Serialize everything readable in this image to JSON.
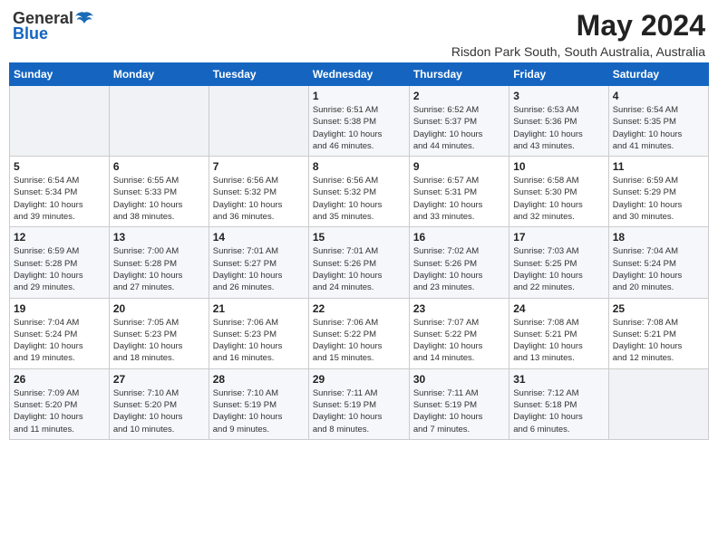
{
  "header": {
    "logo_general": "General",
    "logo_blue": "Blue",
    "month_year": "May 2024",
    "location": "Risdon Park South, South Australia, Australia"
  },
  "weekdays": [
    "Sunday",
    "Monday",
    "Tuesday",
    "Wednesday",
    "Thursday",
    "Friday",
    "Saturday"
  ],
  "weeks": [
    [
      {
        "day": "",
        "info": ""
      },
      {
        "day": "",
        "info": ""
      },
      {
        "day": "",
        "info": ""
      },
      {
        "day": "1",
        "info": "Sunrise: 6:51 AM\nSunset: 5:38 PM\nDaylight: 10 hours\nand 46 minutes."
      },
      {
        "day": "2",
        "info": "Sunrise: 6:52 AM\nSunset: 5:37 PM\nDaylight: 10 hours\nand 44 minutes."
      },
      {
        "day": "3",
        "info": "Sunrise: 6:53 AM\nSunset: 5:36 PM\nDaylight: 10 hours\nand 43 minutes."
      },
      {
        "day": "4",
        "info": "Sunrise: 6:54 AM\nSunset: 5:35 PM\nDaylight: 10 hours\nand 41 minutes."
      }
    ],
    [
      {
        "day": "5",
        "info": "Sunrise: 6:54 AM\nSunset: 5:34 PM\nDaylight: 10 hours\nand 39 minutes."
      },
      {
        "day": "6",
        "info": "Sunrise: 6:55 AM\nSunset: 5:33 PM\nDaylight: 10 hours\nand 38 minutes."
      },
      {
        "day": "7",
        "info": "Sunrise: 6:56 AM\nSunset: 5:32 PM\nDaylight: 10 hours\nand 36 minutes."
      },
      {
        "day": "8",
        "info": "Sunrise: 6:56 AM\nSunset: 5:32 PM\nDaylight: 10 hours\nand 35 minutes."
      },
      {
        "day": "9",
        "info": "Sunrise: 6:57 AM\nSunset: 5:31 PM\nDaylight: 10 hours\nand 33 minutes."
      },
      {
        "day": "10",
        "info": "Sunrise: 6:58 AM\nSunset: 5:30 PM\nDaylight: 10 hours\nand 32 minutes."
      },
      {
        "day": "11",
        "info": "Sunrise: 6:59 AM\nSunset: 5:29 PM\nDaylight: 10 hours\nand 30 minutes."
      }
    ],
    [
      {
        "day": "12",
        "info": "Sunrise: 6:59 AM\nSunset: 5:28 PM\nDaylight: 10 hours\nand 29 minutes."
      },
      {
        "day": "13",
        "info": "Sunrise: 7:00 AM\nSunset: 5:28 PM\nDaylight: 10 hours\nand 27 minutes."
      },
      {
        "day": "14",
        "info": "Sunrise: 7:01 AM\nSunset: 5:27 PM\nDaylight: 10 hours\nand 26 minutes."
      },
      {
        "day": "15",
        "info": "Sunrise: 7:01 AM\nSunset: 5:26 PM\nDaylight: 10 hours\nand 24 minutes."
      },
      {
        "day": "16",
        "info": "Sunrise: 7:02 AM\nSunset: 5:26 PM\nDaylight: 10 hours\nand 23 minutes."
      },
      {
        "day": "17",
        "info": "Sunrise: 7:03 AM\nSunset: 5:25 PM\nDaylight: 10 hours\nand 22 minutes."
      },
      {
        "day": "18",
        "info": "Sunrise: 7:04 AM\nSunset: 5:24 PM\nDaylight: 10 hours\nand 20 minutes."
      }
    ],
    [
      {
        "day": "19",
        "info": "Sunrise: 7:04 AM\nSunset: 5:24 PM\nDaylight: 10 hours\nand 19 minutes."
      },
      {
        "day": "20",
        "info": "Sunrise: 7:05 AM\nSunset: 5:23 PM\nDaylight: 10 hours\nand 18 minutes."
      },
      {
        "day": "21",
        "info": "Sunrise: 7:06 AM\nSunset: 5:23 PM\nDaylight: 10 hours\nand 16 minutes."
      },
      {
        "day": "22",
        "info": "Sunrise: 7:06 AM\nSunset: 5:22 PM\nDaylight: 10 hours\nand 15 minutes."
      },
      {
        "day": "23",
        "info": "Sunrise: 7:07 AM\nSunset: 5:22 PM\nDaylight: 10 hours\nand 14 minutes."
      },
      {
        "day": "24",
        "info": "Sunrise: 7:08 AM\nSunset: 5:21 PM\nDaylight: 10 hours\nand 13 minutes."
      },
      {
        "day": "25",
        "info": "Sunrise: 7:08 AM\nSunset: 5:21 PM\nDaylight: 10 hours\nand 12 minutes."
      }
    ],
    [
      {
        "day": "26",
        "info": "Sunrise: 7:09 AM\nSunset: 5:20 PM\nDaylight: 10 hours\nand 11 minutes."
      },
      {
        "day": "27",
        "info": "Sunrise: 7:10 AM\nSunset: 5:20 PM\nDaylight: 10 hours\nand 10 minutes."
      },
      {
        "day": "28",
        "info": "Sunrise: 7:10 AM\nSunset: 5:19 PM\nDaylight: 10 hours\nand 9 minutes."
      },
      {
        "day": "29",
        "info": "Sunrise: 7:11 AM\nSunset: 5:19 PM\nDaylight: 10 hours\nand 8 minutes."
      },
      {
        "day": "30",
        "info": "Sunrise: 7:11 AM\nSunset: 5:19 PM\nDaylight: 10 hours\nand 7 minutes."
      },
      {
        "day": "31",
        "info": "Sunrise: 7:12 AM\nSunset: 5:18 PM\nDaylight: 10 hours\nand 6 minutes."
      },
      {
        "day": "",
        "info": ""
      }
    ]
  ]
}
